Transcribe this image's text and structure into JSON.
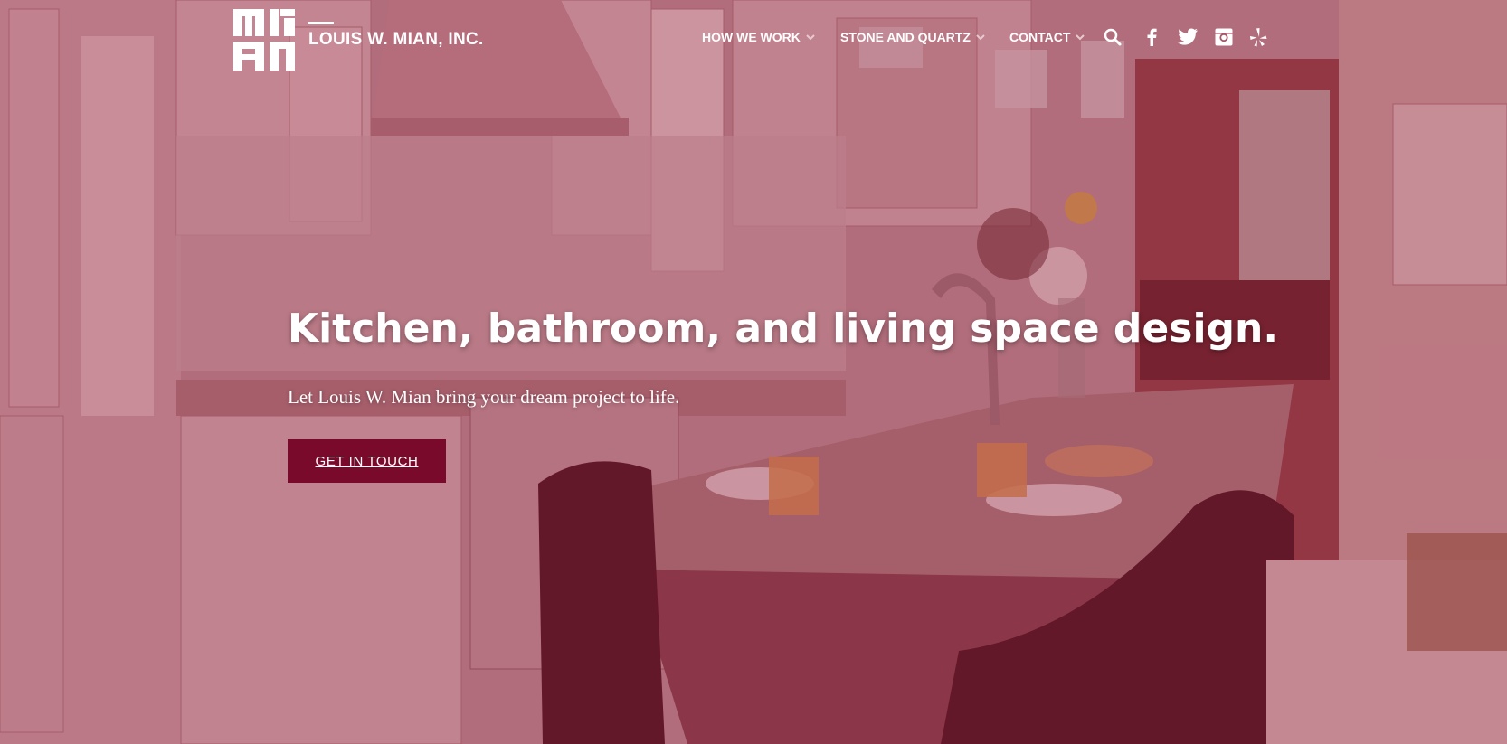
{
  "brand": {
    "logo_text": "MI AN",
    "name": "LOUIS W. MIAN, INC."
  },
  "nav": {
    "items": [
      {
        "label": "HOW WE WORK",
        "icon": "chevron-down-icon"
      },
      {
        "label": "STONE AND QUARTZ",
        "icon": "chevron-down-icon"
      },
      {
        "label": "CONTACT",
        "icon": "chevron-down-icon"
      }
    ],
    "icons": [
      "search-icon",
      "facebook-icon",
      "twitter-icon",
      "instagram-icon",
      "yelp-icon"
    ]
  },
  "hero": {
    "headline": "Kitchen, bathroom, and living space design.",
    "subhead": "Let Louis W. Mian bring your dream project to life.",
    "cta_label": "GET IN TOUCH"
  },
  "colors": {
    "overlay": "#8c1432",
    "cta_background": "#7a0a2c",
    "text": "#ffffff"
  }
}
